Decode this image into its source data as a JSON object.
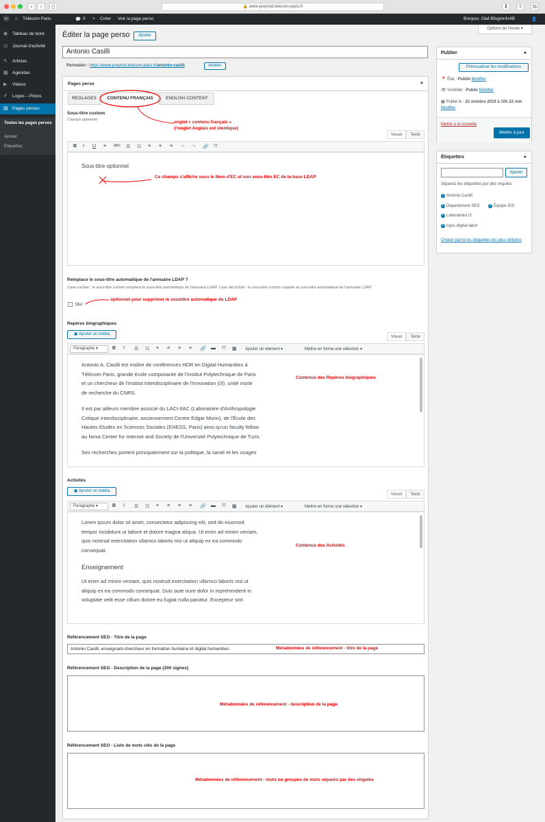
{
  "browser": {
    "url": "www-preprod.telecom-paris.fr"
  },
  "adminbar": {
    "site": "Télécom Paris",
    "comments": "0",
    "new": "Créer",
    "view": "Voir la page perso",
    "greeting": "Bonjour, Olaf-Bfxgmr4z4B"
  },
  "sidebar": {
    "items": [
      {
        "label": "Tableau de bord",
        "icon": "dashboard-icon",
        "glyph": "◉"
      },
      {
        "label": "Journal d'activité",
        "icon": "activity-icon",
        "glyph": "◷"
      },
      {
        "label": "Articles",
        "icon": "pin-icon",
        "glyph": "✎"
      },
      {
        "label": "Agendas",
        "icon": "calendar-icon",
        "glyph": "▦"
      },
      {
        "label": "Videos",
        "icon": "video-icon",
        "glyph": "▶"
      },
      {
        "label": "Logos – Pictos",
        "icon": "brush-icon",
        "glyph": "✐"
      },
      {
        "label": "Pages persos",
        "icon": "page-icon",
        "glyph": "▤"
      }
    ],
    "sub": [
      "Toutes les pages persos",
      "Ajouter",
      "Étiquettes"
    ]
  },
  "page": {
    "title": "Éditer la page perso",
    "add_label": "Ajouter",
    "screen_options": "Options de l'écran ▾",
    "post_title": "Antonio Casilli",
    "permalink_label": "Permalien :",
    "permalink_url": "https://www-preprod.telecom-paris.fr/",
    "permalink_slug": "antonio-casilli",
    "modify": "Modifier"
  },
  "metabox": {
    "title": "Pages perso",
    "tabs": [
      "REGLAGES",
      "CONTENU FRANÇAIS",
      "ENGLISH CONTENT"
    ]
  },
  "subtitle": {
    "label": "Sous-titre custom",
    "hint": "Champs optionnel",
    "content": "Sous-titre optionnel",
    "tab_visual": "Visuel",
    "tab_text": "Texte"
  },
  "ldap": {
    "label": "Remplace le sous-titre automatique de l'annuaire LDAP ?",
    "hint": "Case cochée : le sous-titre custom remplace le sous-titre automatique de l'annuaire LDAP. Case décochée : le sous-titre custom s'ajoute au sous-titre automatique de l'annuaire LDAP",
    "checkbox": "Oui"
  },
  "bio": {
    "label": "Repères biographiques",
    "add_media": "Ajouter un média",
    "format": "Paragraphe",
    "add_element": "Ajouter un élément ▾",
    "format_sel": "Mettre en forme une sélection ▾",
    "lines": [
      "Antonio A. Casilli est maître de conférences HDR en Digital Humanities à",
      "Télécom Paris, grande école composante de l'Institut Polytechnique de Paris",
      "et un chercheur de l'Institut Interdisciplinaire de l'Innovation (i3), unité mixte",
      "de recherche du CNRS.",
      "",
      "Il est par ailleurs membre associé du LACI-IIAC (Laboratoire d'Anthropologie",
      "Critique Interdisciplinaire, anciennement Centre Edgar Morin), de l'École des",
      "Hautes Etudes en Sciences Sociales (EHESS, Paris) ainsi qu'un faculty fellow",
      "au Nexa Center for Internet and Society de l'Université Polytechnique de Turin.",
      "",
      "Ses recherches portent principalement sur la politique, la santé et les usages"
    ]
  },
  "activities": {
    "label": "Activités",
    "lines": [
      "Lorem ipsum dolor sit amet, consectetur adipiscing elit, sed do eiusmod",
      "tempor incididunt ut labore et dolore magna aliqua. Ut enim ad minim veniam,",
      "quis nostrud exercitation ullamco laboris nisi ut aliquip ex ea commodo",
      "consequat."
    ],
    "heading": "Enseignement",
    "lines2": [
      "Ut enim ad minim veniam, quis nostrud exercitation ullamco laboris nisi ut",
      "aliquip ex ea commodo consequat. Duis aute irure dolor in reprehenderit in",
      "voluptate velit esse cillum dolore eu fugiat nulla pariatur. Excepteur sint"
    ]
  },
  "seo": {
    "title_label": "Référencement SEO - Titre de la page",
    "title_value": "Antonio Casilli, enseignant-chercheur en formation humaine et digital humanities",
    "desc_label": "Référencement SEO - Description de la page (200 signes)",
    "kw_label": "Référencement SEO - Liste de mots clés de la page"
  },
  "publish": {
    "title": "Publier",
    "preview": "Prévisualiser les modifications",
    "state_label": "État : ",
    "state": "Publié",
    "visibility_label": "Visibilité : ",
    "visibility": "Public",
    "published_label": "Publié le : ",
    "published_date": "22 octobre 2019 à 10h 22 min",
    "trash": "Mettre à la corbeille",
    "update": "Mettre à jour"
  },
  "tags": {
    "title": "Étiquettes",
    "add": "Ajouter",
    "hint": "Séparez les étiquettes par des virgules",
    "items": [
      "Antonio Casilli",
      "Département SES",
      "Équipe IDS",
      "Laboratoire i3",
      "topic-digital-labor"
    ],
    "choose": "Choisir parmi les étiquettes les plus utilisées"
  },
  "annotations": {
    "tab": "onglet « contenu français »",
    "tab2": "(l'onglet Anglais est identique)",
    "subtitle": "Ce champs s'affiche sous le Nom d'EC et son sous-titre EC de la base LDAP",
    "ldap": "optionnel pour supprimer le soustitre automatique du LDAP",
    "bio": "Contenus des Repères biographiques",
    "act": "Contenus des Activités",
    "seo_title": "Métadonnées de référencement - titre de la page",
    "seo_desc": "Métadonnées de référencement - description de la page",
    "seo_kw": "Métadonnées de référencement - mots ou groupes de mots séparés par des virgules"
  },
  "colors": {
    "accent": "#0073aa",
    "annotation": "#e00000",
    "admin_bg": "#23282d"
  }
}
